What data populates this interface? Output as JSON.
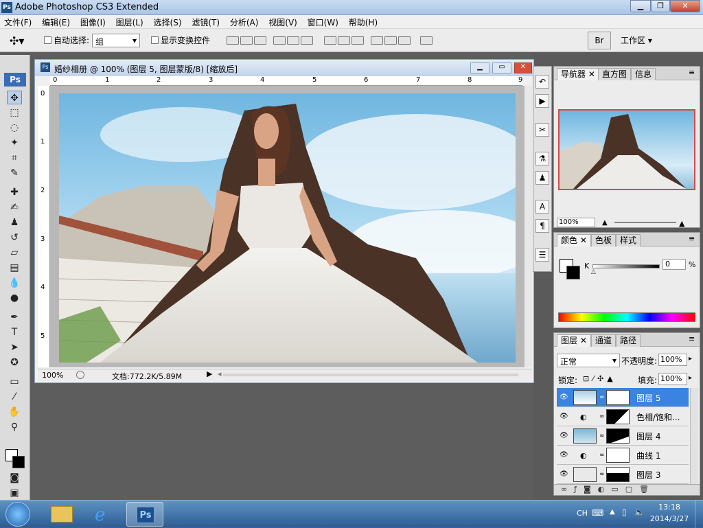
{
  "window": {
    "title": "Adobe Photoshop CS3 Extended",
    "app_badge": "Ps"
  },
  "menu": [
    "文件(F)",
    "编辑(E)",
    "图像(I)",
    "图层(L)",
    "选择(S)",
    "滤镜(T)",
    "分析(A)",
    "视图(V)",
    "窗口(W)",
    "帮助(H)"
  ],
  "options": {
    "auto_select_label": "自动选择:",
    "auto_select_value": "组",
    "show_transform_label": "显示变换控件",
    "workspace_label": "工作区 ▾"
  },
  "document": {
    "title": "婚纱相册 @ 100% (图层 5, 图层蒙版/8) [缩放后]",
    "ruler_top": [
      "0",
      "1",
      "2",
      "3",
      "4",
      "5",
      "6",
      "7",
      "8",
      "9"
    ],
    "ruler_left": [
      "0",
      "1",
      "2",
      "3",
      "4",
      "5"
    ],
    "zoom": "100%",
    "doc_info": "文档:772.2K/5.89M"
  },
  "navigator": {
    "tabs": [
      "导航器",
      "直方图",
      "信息"
    ],
    "zoom": "100%"
  },
  "color_panel": {
    "tabs": [
      "颜色",
      "色板",
      "样式"
    ],
    "channel": "K",
    "value": "0",
    "unit": "%"
  },
  "layers_panel": {
    "tabs": [
      "图层",
      "通道",
      "路径"
    ],
    "blend_mode": "正常",
    "opacity_label": "不透明度:",
    "opacity": "100%",
    "lock_label": "锁定:",
    "fill_label": "填充:",
    "fill": "100%",
    "layers": [
      {
        "name": "图层 5",
        "selected": true
      },
      {
        "name": "色相/饱和...",
        "selected": false
      },
      {
        "name": "图层 4",
        "selected": false
      },
      {
        "name": "曲线 1",
        "selected": false
      },
      {
        "name": "图层 3",
        "selected": false
      }
    ]
  },
  "taskbar": {
    "lang": "CH",
    "time": "13:18",
    "date": "2014/3/27",
    "ps_label": "Ps"
  }
}
